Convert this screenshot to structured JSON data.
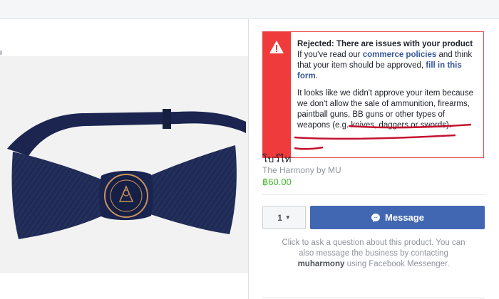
{
  "alert": {
    "title": "Rejected: There are issues with your product",
    "intro": "If you've read our",
    "policies_link": "commerce policies",
    "mid": "and think that your item should be approved,",
    "form_link": "fill in this form",
    "period": ".",
    "detail": "It looks like we didn't approve your item because we don't allow the sale of ammunition, firearms, paintball guns, BB guns or other types of weapons (e.g. knives, daggers or swords).",
    "icon": "warning-triangle-icon",
    "colors": {
      "stripe": "#ef3b3b",
      "border": "#e64848",
      "underline": "#c4122f"
    }
  },
  "product": {
    "title": "โบว์ไท",
    "seller": "The Harmony by MU",
    "price": "฿60.00",
    "price_color": "#42b72a",
    "image_desc_icon": "bow-tie-image"
  },
  "actions": {
    "quantity": "1",
    "message_label": "Message",
    "message_icon": "messenger-icon",
    "button_color": "#4267b2"
  },
  "help": {
    "before": "Click to ask a question about this product. You can also message the business by contacting",
    "business": "muharmony",
    "after": "using Facebook Messenger."
  }
}
